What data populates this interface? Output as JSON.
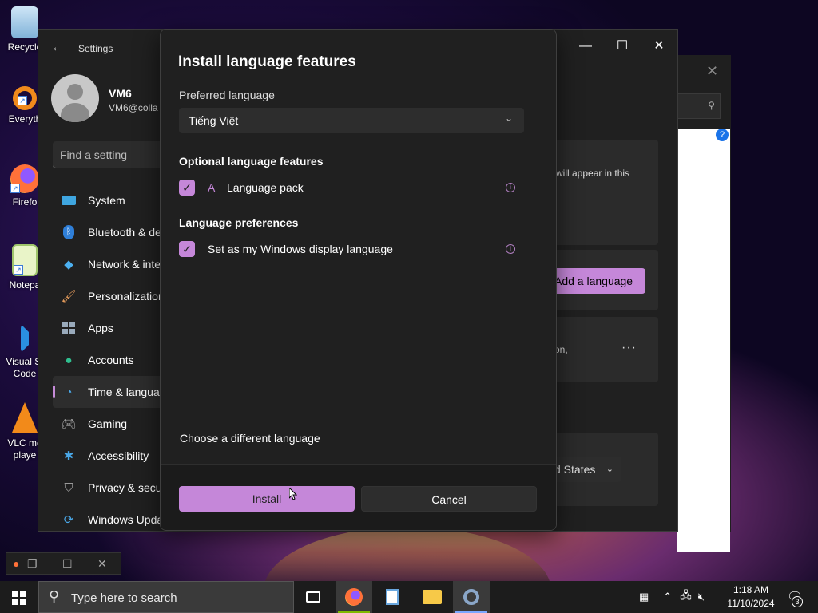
{
  "desktop": {
    "icons": [
      {
        "label": "Recycle",
        "icon": "recycle-bin-icon"
      },
      {
        "label": "Everyth",
        "icon": "everything-search-icon"
      },
      {
        "label": "Firefo",
        "icon": "firefox-icon"
      },
      {
        "label": "Notepa",
        "icon": "notepad-icon"
      },
      {
        "label": "Visual St Code",
        "icon": "vscode-icon"
      },
      {
        "label": "VLC me playe",
        "icon": "vlc-icon"
      }
    ]
  },
  "settings": {
    "title": "Settings",
    "user": {
      "name": "VM6",
      "email": "VM6@colla"
    },
    "find_placeholder": "Find a setting",
    "nav": [
      {
        "label": "System",
        "icon": "monitor-icon"
      },
      {
        "label": "Bluetooth & de",
        "icon": "bluetooth-icon"
      },
      {
        "label": "Network & inte",
        "icon": "wifi-icon"
      },
      {
        "label": "Personalization",
        "icon": "brush-icon"
      },
      {
        "label": "Apps",
        "icon": "apps-icon"
      },
      {
        "label": "Accounts",
        "icon": "person-icon"
      },
      {
        "label": "Time & langua",
        "icon": "clock-globe-icon",
        "active": true
      },
      {
        "label": "Gaming",
        "icon": "gamepad-icon"
      },
      {
        "label": "Accessibility",
        "icon": "accessibility-icon"
      },
      {
        "label": "Privacy & secu",
        "icon": "shield-icon"
      },
      {
        "label": "Windows Upda",
        "icon": "update-icon"
      }
    ],
    "content": {
      "card1_text": "will appear in this",
      "add_language_label": "Add a language",
      "card3_text": "on,",
      "more_label": "···",
      "region_value": "d States"
    }
  },
  "dialog": {
    "title": "Install language features",
    "preferred_language_label": "Preferred language",
    "preferred_language_value": "Tiếng Việt",
    "optional_features_header": "Optional language features",
    "language_pack_label": "Language pack",
    "preferences_header": "Language preferences",
    "display_language_label": "Set as my Windows display language",
    "choose_different_label": "Choose a different language",
    "install_label": "Install",
    "cancel_label": "Cancel"
  },
  "taskbar": {
    "search_placeholder": "Type here to search",
    "time": "1:18 AM",
    "date": "11/10/2024",
    "notification_count": "3"
  },
  "colors": {
    "accent": "#c587d9",
    "window_bg": "#202020",
    "taskbar_bg": "#1c1c1c"
  }
}
